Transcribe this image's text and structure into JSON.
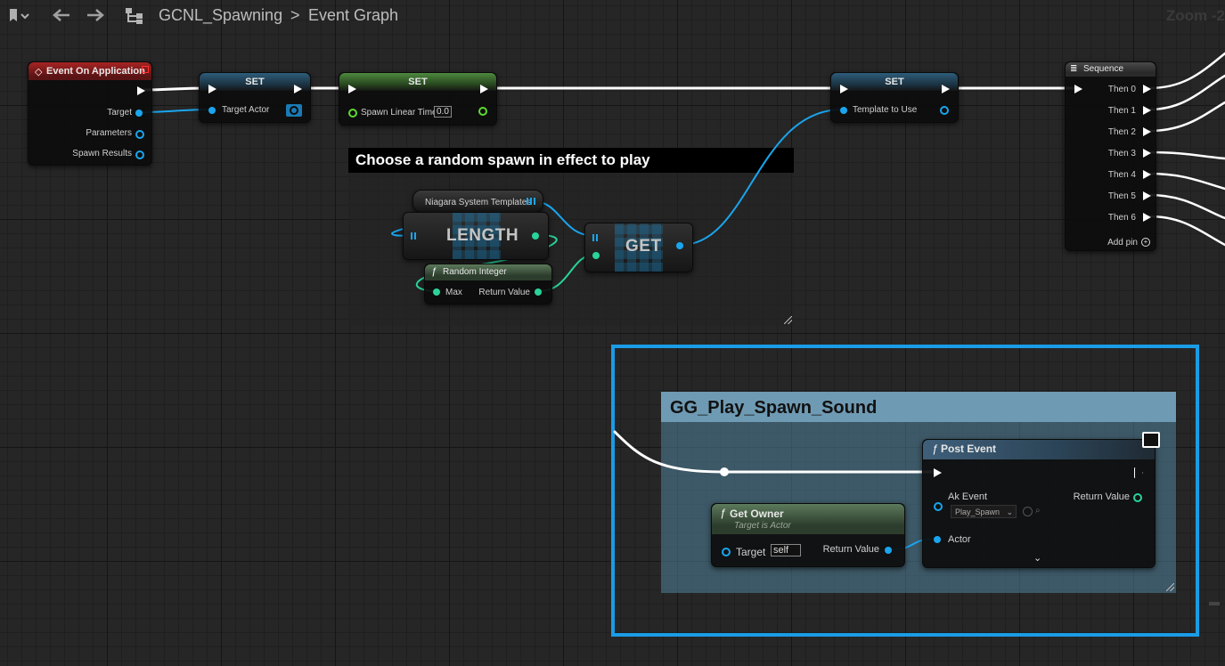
{
  "toolbar": {
    "breadcrumb_asset": "GCNL_Spawning",
    "breadcrumb_separator": ">",
    "breadcrumb_graph": "Event Graph",
    "zoom_label": "Zoom -2"
  },
  "nodes": {
    "event_on_application": {
      "title": "Event On Application",
      "pins": [
        "Target",
        "Parameters",
        "Spawn Results"
      ],
      "color": "#a82424"
    },
    "set_target_actor": {
      "title": "SET",
      "pin": "Target Actor"
    },
    "set_spawn_linear_time": {
      "title": "SET",
      "pin": "Spawn Linear Time",
      "value": "0.0"
    },
    "set_template_to_use": {
      "title": "SET",
      "pin": "Template to Use"
    },
    "sequence": {
      "title": "Sequence",
      "pins": [
        "Then 0",
        "Then 1",
        "Then 2",
        "Then 3",
        "Then 4",
        "Then 5",
        "Then 6"
      ],
      "add_pin": "Add pin"
    },
    "niagara_templates": {
      "title": "Niagara System Templates"
    },
    "length": {
      "title": "LENGTH"
    },
    "get": {
      "title": "GET"
    },
    "random_integer": {
      "title": "Random Integer",
      "pin_in": "Max",
      "pin_out": "Return Value"
    },
    "get_owner": {
      "title": "Get Owner",
      "subtitle": "Target is Actor",
      "pin_in": "Target",
      "pin_in_value": "self",
      "pin_out": "Return Value"
    },
    "post_event": {
      "title": "Post Event",
      "pin_ak_event": "Ak Event",
      "ak_event_value": "Play_Spawn",
      "pin_actor": "Actor",
      "pin_out": "Return Value"
    }
  },
  "comments": {
    "random_spawn": "Choose a random spawn in effect to play",
    "play_sound": "GG_Play_Spawn_Sound"
  },
  "colors": {
    "object_pin": "#1aa5ee",
    "int_pin": "#29d49a",
    "float_pin": "#5ddb30",
    "selection": "#1a9ce6"
  }
}
